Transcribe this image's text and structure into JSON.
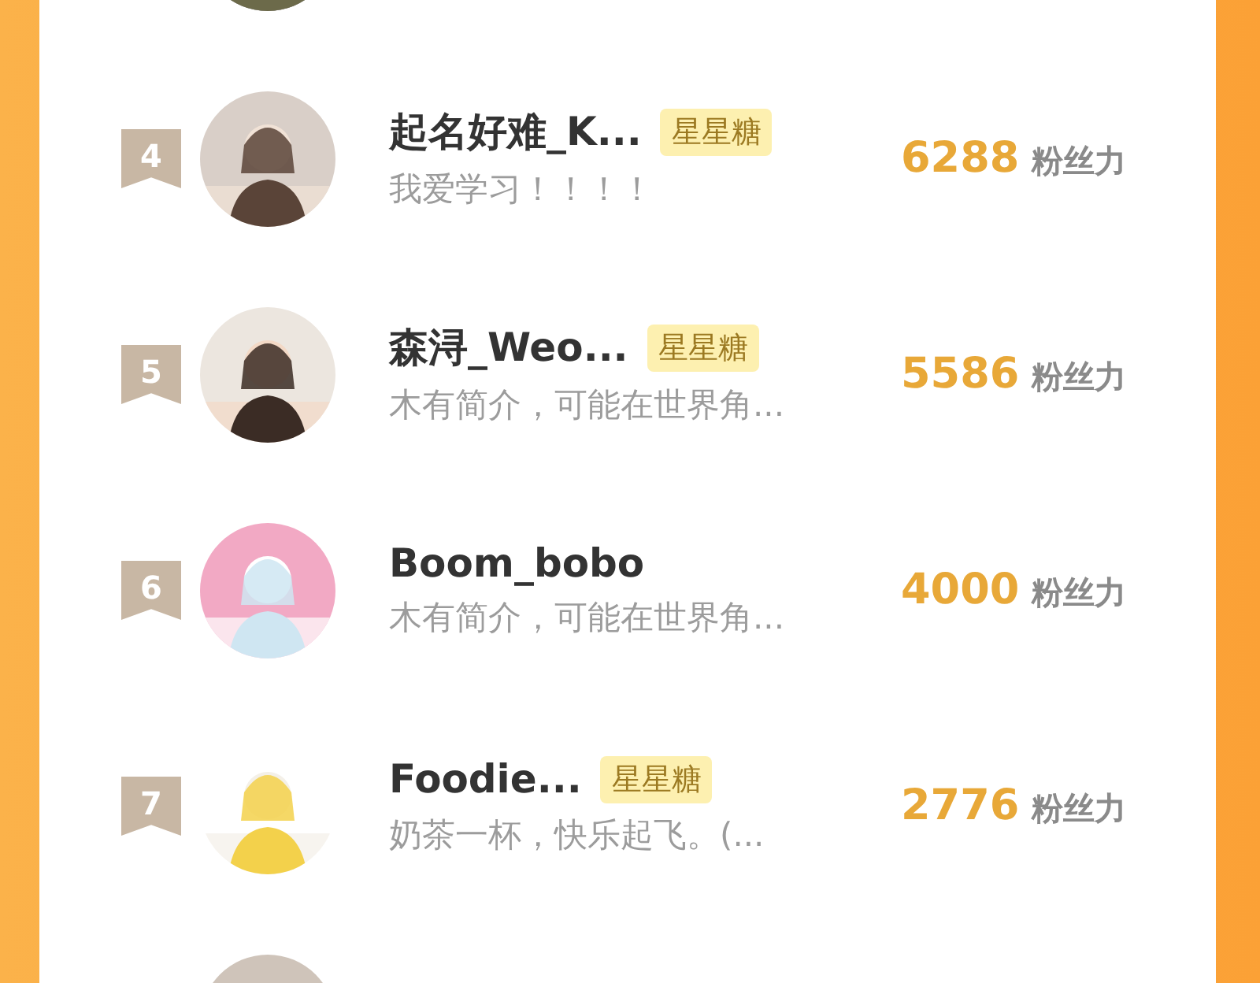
{
  "rows": [
    {
      "kind": "cut"
    },
    {
      "kind": "entry",
      "rank": "4",
      "name": "起名好难_K...",
      "tag": "星星糖",
      "bio": "我爱学习！！！！",
      "score": "6288",
      "unit": "粉丝力"
    },
    {
      "kind": "entry",
      "rank": "5",
      "name": "森浔_Weo...",
      "tag": "星星糖",
      "bio": "木有简介，可能在世界角...",
      "score": "5586",
      "unit": "粉丝力"
    },
    {
      "kind": "entry",
      "rank": "6",
      "name": "Boom_bobo",
      "bio": "木有简介，可能在世界角...",
      "score": "4000",
      "unit": "粉丝力"
    },
    {
      "kind": "entry",
      "rank": "7",
      "name": "Foodie...",
      "tag": "星星糖",
      "bio": "奶茶一杯，快乐起飞。(...",
      "score": "2776",
      "unit": "粉丝力"
    },
    {
      "kind": "cut"
    }
  ]
}
